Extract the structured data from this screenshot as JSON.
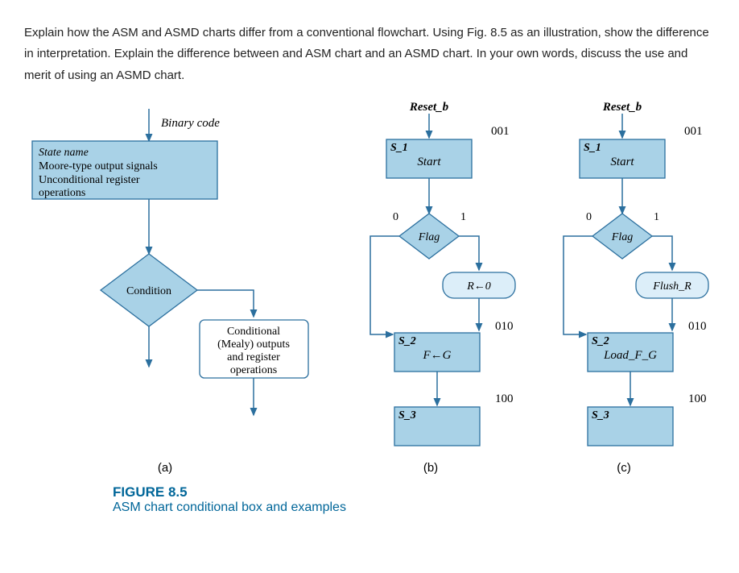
{
  "question": "Explain how the ASM and ASMD charts differ from a conventional flowchart. Using Fig. 8.5 as an illustration, show the difference in interpretation. Explain the difference between and ASM chart and an ASMD chart. In your own words, discuss the use and merit of using an ASMD chart.",
  "legend": {
    "binary_code": "Binary code",
    "state_name": "State name",
    "moore_outputs": "Moore-type output signals",
    "uncond_ops": "Unconditional register operations",
    "condition": "Condition",
    "cond_outputs_l1": "Conditional",
    "cond_outputs_l2": "(Mealy) outputs",
    "cond_outputs_l3": "and register",
    "cond_outputs_l4": "operations"
  },
  "chart_b": {
    "reset": "Reset_b",
    "s1_name": "S_1",
    "s1_label": "Start",
    "s1_code": "001",
    "decision": "Flag",
    "dec_0": "0",
    "dec_1": "1",
    "cond_box": "R←0",
    "s2_name": "S_2",
    "s2_label": "F←G",
    "s2_code": "010",
    "s3_name": "S_3",
    "s3_code": "100"
  },
  "chart_c": {
    "reset": "Reset_b",
    "s1_name": "S_1",
    "s1_label": "Start",
    "s1_code": "001",
    "decision": "Flag",
    "dec_0": "0",
    "dec_1": "1",
    "cond_box": "Flush_R",
    "s2_name": "S_2",
    "s2_label": "Load_F_G",
    "s2_code": "010",
    "s3_name": "S_3",
    "s3_code": "100"
  },
  "captions": {
    "a": "(a)",
    "b": "(b)",
    "c": "(c)"
  },
  "figure": {
    "num": "FIGURE 8.5",
    "title": "ASM chart conditional box and examples"
  }
}
